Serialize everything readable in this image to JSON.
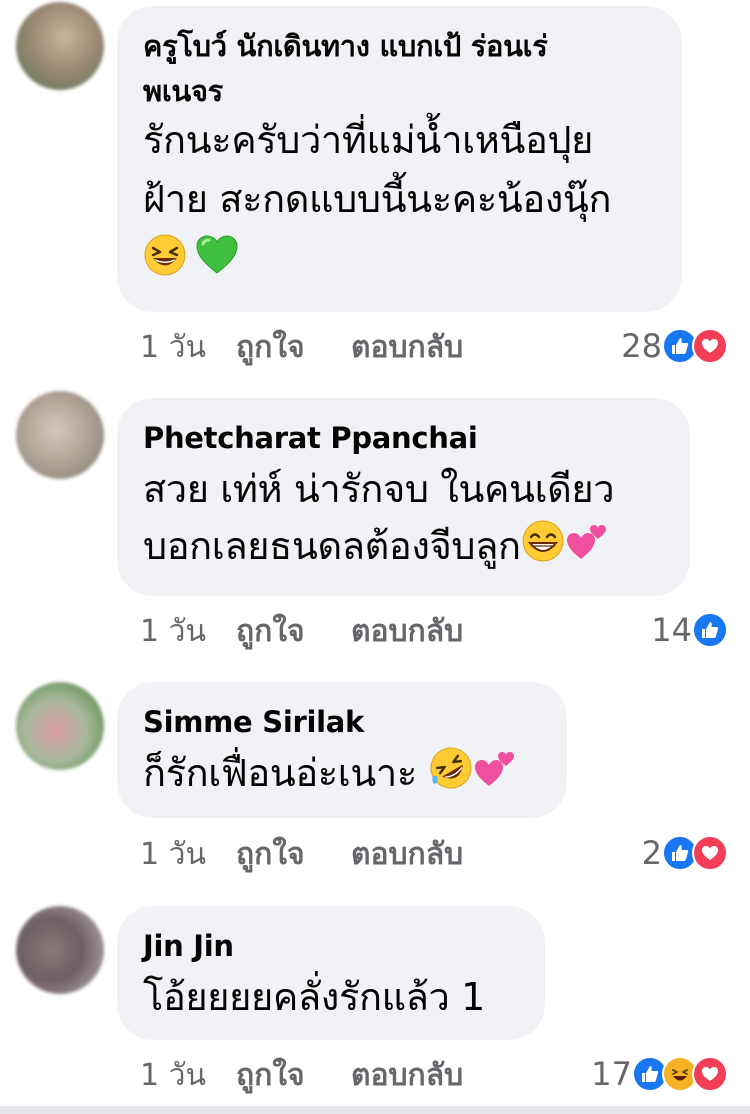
{
  "comments": [
    {
      "author": "ครูโบว์ นักเดินทาง แบกเป้ ร่อนเร่",
      "author_line2": "พเนจร",
      "text_lines": [
        "รักนะครับว่าที่แม่น้ำเหนือปุย",
        "ฝ้าย สะกดแบบนี้นะคะน้องนุ๊ก"
      ],
      "emojis": [
        "grinning-squinting-face",
        "green-heart"
      ],
      "time": "1 วัน",
      "like_label": "ถูกใจ",
      "reply_label": "ตอบกลับ",
      "reaction_count": "28",
      "reactions": [
        "like",
        "love"
      ]
    },
    {
      "author": "Phetcharat Ppanchai",
      "text_lines": [
        "สวย เท่ห์ น่ารักจบ ในคนเดียว",
        "บอกเลยธนดลต้องจีบลูก"
      ],
      "emojis": [
        "grinning-face-smiling-eyes",
        "two-hearts"
      ],
      "time": "1 วัน",
      "like_label": "ถูกใจ",
      "reply_label": "ตอบกลับ",
      "reaction_count": "14",
      "reactions": [
        "like"
      ]
    },
    {
      "author": "Simme Sirilak",
      "text_lines": [
        "ก็รักเฟื่อนอ่ะเนาะ"
      ],
      "emojis": [
        "rolling-on-floor-laughing",
        "two-hearts"
      ],
      "time": "1 วัน",
      "like_label": "ถูกใจ",
      "reply_label": "ตอบกลับ",
      "reaction_count": "2",
      "reactions": [
        "like",
        "love"
      ]
    },
    {
      "author": "Jin Jin",
      "text_lines": [
        "โอ้ยยยยคลั่งรักแล้ว 1"
      ],
      "emojis": [],
      "time": "1 วัน",
      "like_label": "ถูกใจ",
      "reply_label": "ตอบกลับ",
      "reaction_count": "17",
      "reactions": [
        "like",
        "haha",
        "love"
      ]
    }
  ],
  "colors": {
    "bubble": "#f0f2f5",
    "meta_text": "#65676b",
    "like_blue": "#1877f2",
    "love_red": "#f33e58",
    "haha_yellow": "#f7b125"
  }
}
